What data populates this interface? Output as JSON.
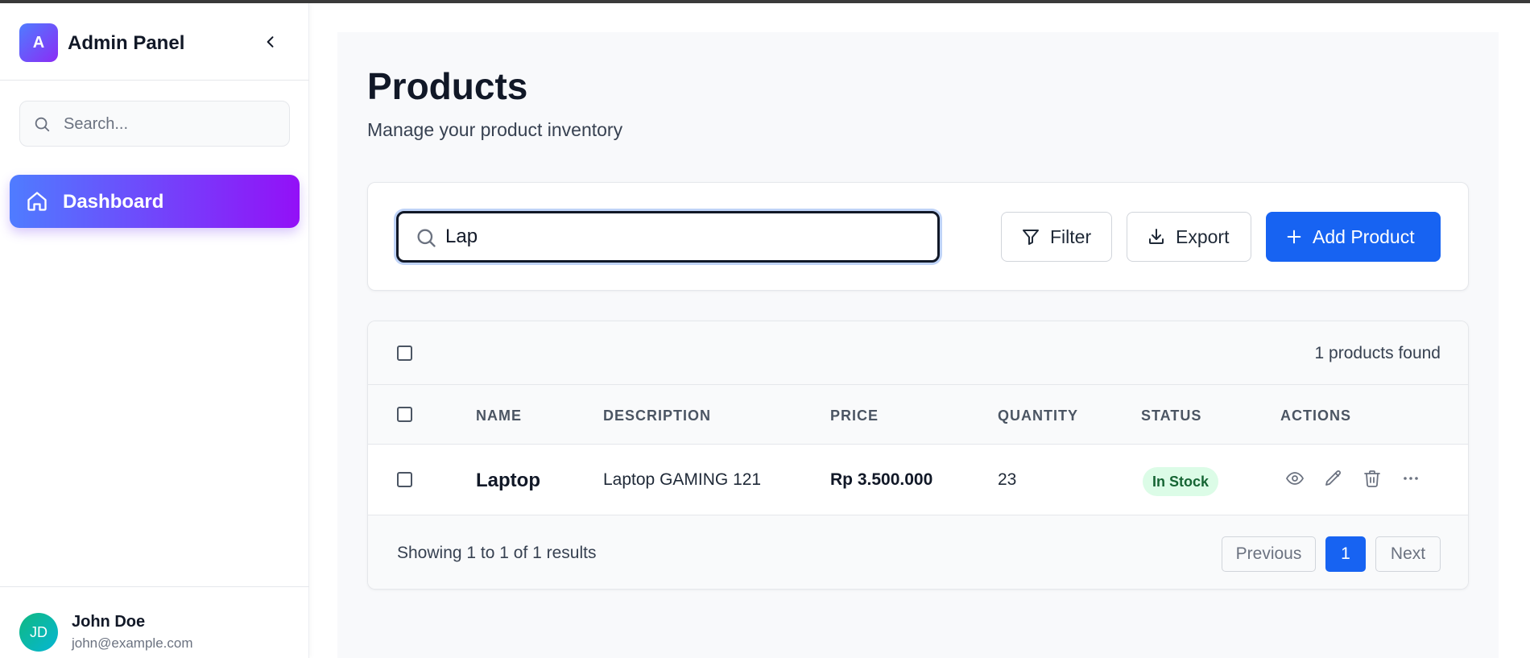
{
  "sidebar": {
    "logo_letter": "A",
    "title": "Admin Panel",
    "search_placeholder": "Search...",
    "nav": [
      {
        "label": "Dashboard",
        "icon": "home-icon",
        "active": true
      }
    ],
    "user": {
      "initials": "JD",
      "name": "John Doe",
      "email": "john@example.com"
    }
  },
  "main": {
    "title": "Products",
    "subtitle": "Manage your product inventory",
    "search_value": "Lap",
    "buttons": {
      "filter": "Filter",
      "export": "Export",
      "add": "Add Product"
    },
    "table": {
      "count_text": "1 products found",
      "columns": [
        "NAME",
        "DESCRIPTION",
        "PRICE",
        "QUANTITY",
        "STATUS",
        "ACTIONS"
      ],
      "rows": [
        {
          "name": "Laptop",
          "description": "Laptop GAMING 121",
          "price": "Rp 3.500.000",
          "quantity": "23",
          "status": "In Stock"
        }
      ],
      "actions": [
        "view-icon",
        "edit-icon",
        "delete-icon",
        "more-icon"
      ],
      "showing_text": "Showing 1 to 1 of 1 results",
      "pagination": {
        "previous": "Previous",
        "current": "1",
        "next": "Next"
      }
    }
  },
  "colors": {
    "primary": "#1763f2",
    "gradient_start": "#4f7cff",
    "gradient_end": "#9310f7",
    "badge_bg": "#dcfce7",
    "badge_text": "#166534"
  }
}
